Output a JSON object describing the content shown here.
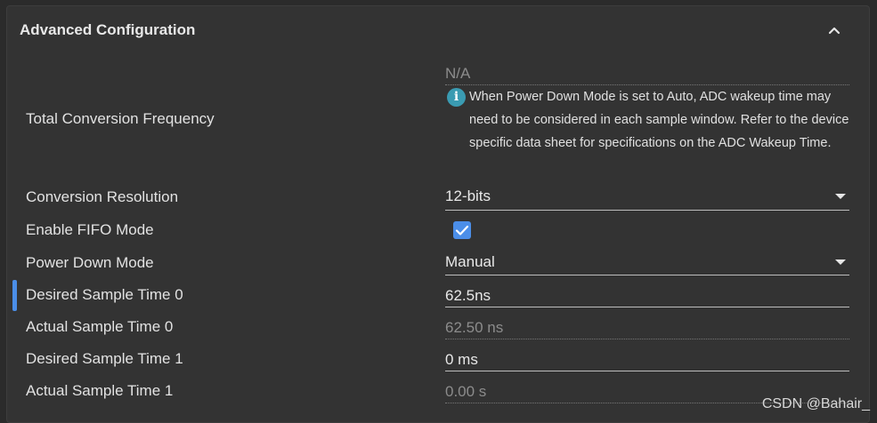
{
  "panel": {
    "title": "Advanced Configuration",
    "collapse_icon": "chevron-up-icon"
  },
  "fields": {
    "total_conversion_frequency": {
      "label": "Total Conversion Frequency",
      "value": "N/A",
      "info_icon": "info-icon",
      "info_text": "When Power Down Mode is set to Auto, ADC wakeup time may need to be considered in each sample window. Refer to the device specific data sheet for specifications on the ADC Wakeup Time."
    },
    "conversion_resolution": {
      "label": "Conversion Resolution",
      "value": "12-bits"
    },
    "enable_fifo_mode": {
      "label": "Enable FIFO Mode",
      "checked": true
    },
    "power_down_mode": {
      "label": "Power Down Mode",
      "value": "Manual"
    },
    "desired_sample_time_0": {
      "label": "Desired Sample Time 0",
      "value": "62.5ns"
    },
    "actual_sample_time_0": {
      "label": "Actual Sample Time 0",
      "value": "62.50 ns"
    },
    "desired_sample_time_1": {
      "label": "Desired Sample Time 1",
      "value": "0 ms"
    },
    "actual_sample_time_1": {
      "label": "Actual Sample Time 1",
      "value": "0.00 s"
    }
  },
  "watermark": "CSDN @Bahair_",
  "colors": {
    "background": "#333333",
    "accent": "#4b8ee8",
    "info": "#3a9bb2",
    "muted_text": "#8c8c8c"
  }
}
